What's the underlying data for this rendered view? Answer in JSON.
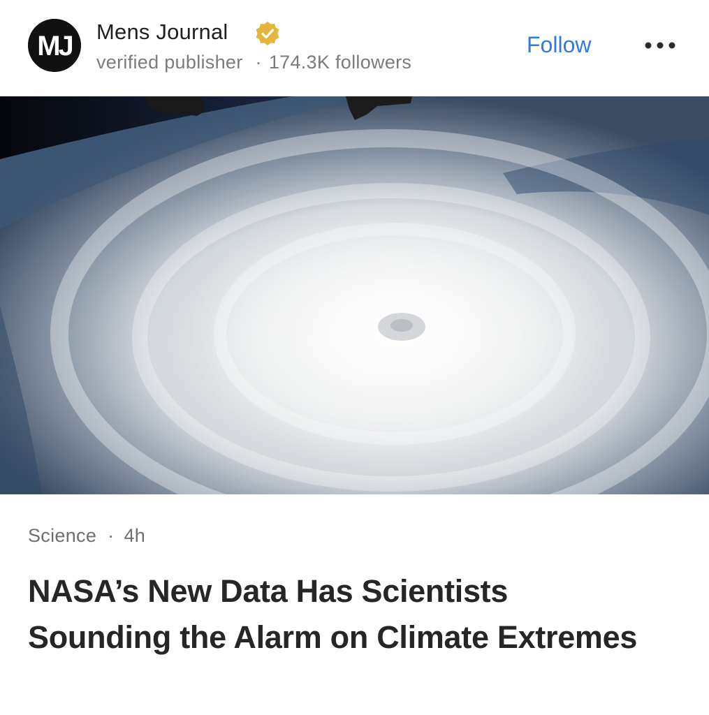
{
  "publisher": {
    "logo_text": "MJ",
    "name": "Mens Journal",
    "status": "verified publisher",
    "followers": "174.3K followers",
    "badge_icon": "verified-check-icon",
    "badge_color": "#e2b53c"
  },
  "actions": {
    "follow_label": "Follow",
    "more_icon": "more-horizontal-icon",
    "follow_color": "#2f7ae5"
  },
  "article": {
    "category": "Science",
    "age": "4h",
    "headline": "NASA’s New Data Has Scientists Sounding the Alarm on Climate Extremes"
  }
}
